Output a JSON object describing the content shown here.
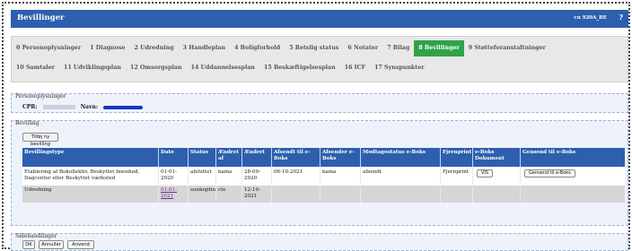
{
  "header": {
    "title": "Bevillinger",
    "code": "cu 920A_BE",
    "help": "?"
  },
  "tabs": {
    "row1": [
      {
        "label": "0 Personoplysninger"
      },
      {
        "label": "1 Diagnose"
      },
      {
        "label": "2 Udredning"
      },
      {
        "label": "3 Handleplan"
      },
      {
        "label": "4 Boligforhold"
      },
      {
        "label": "5 Retslig status"
      },
      {
        "label": "6 Notater"
      },
      {
        "label": "7 Bilag"
      },
      {
        "label": "8 Bevillinger",
        "active": true
      },
      {
        "label": "9 Støtteforanstaltninger"
      }
    ],
    "row2": [
      {
        "label": "10 Samtaler"
      },
      {
        "label": "11 Udviklingsplan"
      },
      {
        "label": "12 Omsorgsplan"
      },
      {
        "label": "14 Uddannelsesplan"
      },
      {
        "label": "15 Beskæftigelsesplan"
      },
      {
        "label": "16 ICF"
      },
      {
        "label": "17 Synspunkter"
      }
    ]
  },
  "person": {
    "legend": "Personoplysninger",
    "cpr_label": "CPR:",
    "name_label": "Navn:"
  },
  "bevilling": {
    "legend": "Bevilling",
    "new_button": "Tilføj ny bevilling",
    "columns": [
      "Bevillingstype",
      "Dato",
      "Status",
      "Ændret af",
      "Ændret",
      "Afsendt til e-Boks",
      "Afsender e-Boks",
      "Modtagestatus e-Boks",
      "Fjernprint",
      "e-Boks Dokument",
      "Gensend til e-Boks"
    ],
    "rows": [
      {
        "type": "Etablering af Bokollektiv, Beskyttet boenhed, Dagcenter eller Beskyttet værksted",
        "dato": "01-01-2020",
        "status": "afsluttet",
        "aendret_af": "kama",
        "aendret": "28-09-2020",
        "afsendt": "06-10-2021",
        "afsender": "kama",
        "modtagestatus": "afsendt",
        "fjernprint": "Fjernprint",
        "dokument_button": "VIS",
        "gensend_button": "Gensend til e-Boks"
      },
      {
        "type": "Udredning",
        "dato": "01-01-2021",
        "status": "sunkopting",
        "aendret_af": "clo",
        "aendret": "12-10-2021",
        "afsendt": "",
        "afsender": "",
        "modtagestatus": "",
        "fjernprint": "",
        "dokument_button": "",
        "gensend_button": ""
      }
    ]
  },
  "sidehandlinger": {
    "legend": "Sidehandlinger",
    "ok": "OK",
    "annuller": "Annuller",
    "anvend": "Anvend"
  },
  "colors": {
    "titlebar": "#2d5fae",
    "active_tab": "#2fa34a",
    "table_header": "#2d5fae"
  }
}
